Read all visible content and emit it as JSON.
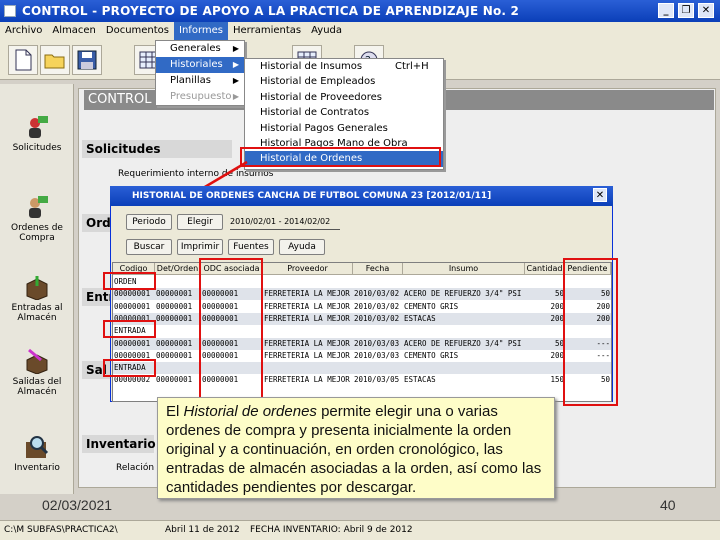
{
  "window": {
    "title": "CONTROL - PROYECTO DE APOYO A LA PRACTICA DE APRENDIZAJE No. 2"
  },
  "menubar": [
    "Archivo",
    "Almacen",
    "Documentos",
    "Informes",
    "Herramientas",
    "Ayuda"
  ],
  "menu_informes": [
    {
      "label": "Generales",
      "state": "normal"
    },
    {
      "label": "Historiales",
      "state": "highlight"
    },
    {
      "label": "Planillas",
      "state": "normal"
    },
    {
      "label": "Presupuesto",
      "state": "disabled"
    }
  ],
  "menu_historiales": [
    {
      "label": "Historial de Insumos",
      "shortcut": "Ctrl+H"
    },
    {
      "label": "Historial de Empleados",
      "shortcut": ""
    },
    {
      "label": "Historial de Proveedores",
      "shortcut": ""
    },
    {
      "label": "Historial de Contratos",
      "shortcut": ""
    },
    {
      "label": "Historial Pagos Generales",
      "shortcut": ""
    },
    {
      "label": "Historial Pagos Mano de Obra",
      "shortcut": ""
    },
    {
      "label": "Historial de Ordenes",
      "shortcut": ""
    }
  ],
  "sidebar": [
    {
      "label": "Solicitudes"
    },
    {
      "label": "Ordenes de Compra"
    },
    {
      "label": "Entradas al Almacén"
    },
    {
      "label": "Salidas del Almacén"
    },
    {
      "label": "Inventario"
    }
  ],
  "main": {
    "header": "CONTROL -",
    "sections": {
      "solicitudes": "Solicitudes",
      "solicitudes_sub": "Requerimiento interno de insumos",
      "ordenes": "Ord",
      "entradas": "Entr",
      "salidas": "Sal",
      "inventario": "Inventario",
      "inventario_sub": "Relación"
    }
  },
  "dialog": {
    "title": "HISTORIAL DE ORDENES  CANCHA DE FUTBOL COMUNA 23 [2012/01/11]",
    "buttons_row1": [
      "Periodo",
      "Elegir"
    ],
    "period": "2010/02/01 - 2014/02/02",
    "buttons_row2": [
      "Buscar",
      "Imprimir",
      "Fuentes",
      "Ayuda"
    ],
    "columns": [
      "Codigo",
      "Det/Orden",
      "ODC asociada",
      "Proveedor",
      "Fecha",
      "Insumo",
      "Cantidad",
      "Pendiente"
    ],
    "rows": [
      {
        "type": "label",
        "cells": [
          "ORDEN",
          "",
          "",
          "",
          "",
          "",
          "",
          ""
        ]
      },
      {
        "type": "data",
        "cells": [
          "00000001",
          "00000001",
          "00000001",
          "FERRETERIA LA MEJOR",
          "2010/03/02",
          "ACERO DE REFUERZO 3/4\" PSI",
          "50",
          "50"
        ]
      },
      {
        "type": "data",
        "cells": [
          "00000001",
          "00000001",
          "00000001",
          "FERRETERIA LA MEJOR",
          "2010/03/02",
          "CEMENTO GRIS",
          "200",
          "200"
        ]
      },
      {
        "type": "data",
        "cells": [
          "00000001",
          "00000001",
          "00000001",
          "FERRETERIA LA MEJOR",
          "2010/03/02",
          "ESTACAS",
          "200",
          "200"
        ]
      },
      {
        "type": "label",
        "cells": [
          "ENTRADA",
          "",
          "",
          "",
          "",
          "",
          "",
          ""
        ]
      },
      {
        "type": "data",
        "cells": [
          "00000001",
          "00000001",
          "00000001",
          "FERRETERIA LA MEJOR",
          "2010/03/03",
          "ACERO DE REFUERZO 3/4\" PSI",
          "50",
          "---"
        ]
      },
      {
        "type": "data",
        "cells": [
          "00000001",
          "00000001",
          "00000001",
          "FERRETERIA LA MEJOR",
          "2010/03/03",
          "CEMENTO GRIS",
          "200",
          "---"
        ]
      },
      {
        "type": "label",
        "cells": [
          "ENTRADA",
          "",
          "",
          "",
          "",
          "",
          "",
          ""
        ]
      },
      {
        "type": "data",
        "cells": [
          "00000002",
          "00000001",
          "00000001",
          "FERRETERIA LA MEJOR",
          "2010/03/05",
          "ESTACAS",
          "150",
          "50"
        ]
      }
    ]
  },
  "caption": {
    "before": "El ",
    "emph": "Historial de ordenes",
    "after": " permite elegir una o varias ordenes de compra y presenta inicialmente la orden original y a continuación, en orden cronológico, las entradas de almacén asociadas a la orden, así como las cantidades pendientes por descargar."
  },
  "footer": {
    "date": "02/03/2021",
    "page": "40"
  },
  "statusbar": [
    "C:\\M SUBFAS\\PRACTICA2\\",
    "Abril 11 de 2012",
    "FECHA INVENTARIO: Abril 9 de 2012"
  ],
  "colors": {
    "highlight": "#316ac5",
    "annotation": "#e01010",
    "titlebar": "#0b3fb8"
  }
}
